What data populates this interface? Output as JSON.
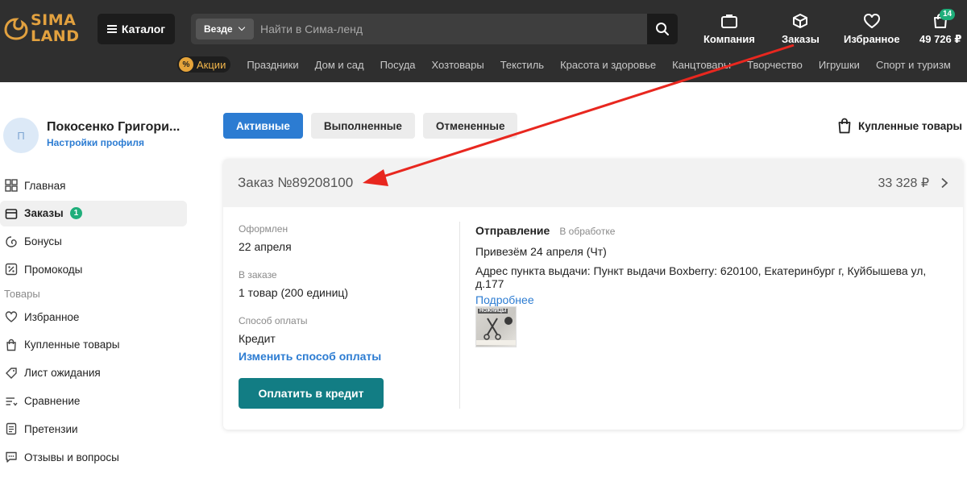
{
  "header": {
    "logo_line1": "SIMA",
    "logo_line2": "LAND",
    "catalog_label": "Каталог",
    "search_scope": "Везде",
    "search_placeholder": "Найти в Сима-ленд",
    "nav": {
      "company": "Компания",
      "orders": "Заказы",
      "favorites": "Избранное",
      "cart_total": "49 726 ₽",
      "cart_count": "14"
    },
    "categories": {
      "promo": "Акции",
      "items": [
        "Праздники",
        "Дом и сад",
        "Посуда",
        "Хозтовары",
        "Текстиль",
        "Красота и здоровье",
        "Канцтовары",
        "Творчество",
        "Игрушки",
        "Спорт и туризм"
      ]
    }
  },
  "profile": {
    "avatar_letter": "П",
    "name": "Покосенко Григори...",
    "settings_link": "Настройки профиля"
  },
  "sidebar": {
    "main_items": [
      {
        "label": "Главная"
      },
      {
        "label": "Заказы",
        "badge": "1"
      },
      {
        "label": "Бонусы"
      },
      {
        "label": "Промокоды"
      }
    ],
    "group_goods": "Товары",
    "goods_items": [
      {
        "label": "Избранное"
      },
      {
        "label": "Купленные товары"
      },
      {
        "label": "Лист ожидания"
      },
      {
        "label": "Сравнение"
      },
      {
        "label": "Претензии"
      },
      {
        "label": "Отзывы и вопросы"
      }
    ]
  },
  "tabs": [
    "Активные",
    "Выполненные",
    "Отмененные"
  ],
  "bought_link": "Купленные товары",
  "order": {
    "title": "Заказ №89208100",
    "sum": "33 328 ₽",
    "placed_label": "Оформлен",
    "placed_value": "22 апреля",
    "in_order_label": "В заказе",
    "in_order_value": "1 товар (200 единиц)",
    "payment_label": "Способ оплаты",
    "payment_value": "Кредит",
    "change_payment_link": "Изменить способ оплаты",
    "pay_button": "Оплатить в кредит",
    "shipment_title": "Отправление",
    "shipment_status": "В обработке",
    "delivery_date": "Привезём 24 апреля (Чт)",
    "pickup_address": "Адрес пункта выдачи: Пункт выдачи Boxberry: 620100, Екатеринбург г, Куйбышева ул, д.177",
    "more_link": "Подробнее",
    "thumb_label": "НОЖНИЦЫ"
  },
  "colors": {
    "header_bg": "#2f2f2f",
    "accent_blue": "#2c7cd2",
    "pay_button": "#127d84",
    "badge_green": "#1fae7a",
    "logo_gold": "#e2a13f",
    "annotation_red": "#e8271f"
  }
}
